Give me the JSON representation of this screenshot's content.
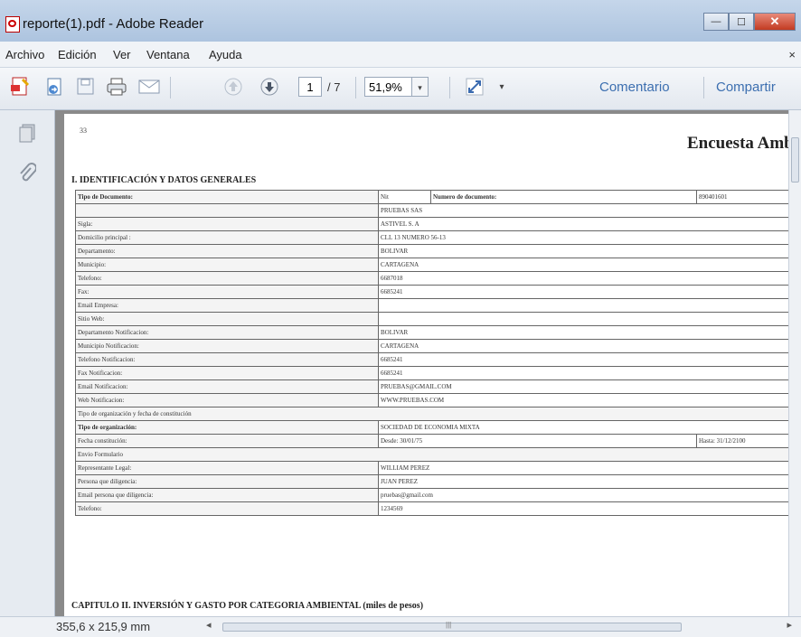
{
  "window": {
    "title": "reporte(1).pdf - Adobe Reader",
    "minimize": "—",
    "maximize": "☐",
    "close": "✕"
  },
  "menu": {
    "items": [
      "Archivo",
      "Edición",
      "Ver",
      "Ventana",
      "Ayuda"
    ],
    "close": "×"
  },
  "toolbar": {
    "page_current": "1",
    "page_total": "/ 7",
    "zoom": "51,9%",
    "comment_label": "Comentario",
    "share_label": "Compartir",
    "dropdown_arrow": "▾"
  },
  "document": {
    "header_small": "33",
    "title": "Encuesta Ambi",
    "section1": "I. IDENTIFICACIÓN Y DATOS GENERALES",
    "doc_type": {
      "label": "Tipo de Documento:",
      "value": "Nit",
      "number_label": "Numero de documento:",
      "number": "890401601"
    },
    "rows": [
      {
        "label": "",
        "value": "PRUEBAS SAS"
      },
      {
        "label": "Sigla:",
        "value": "ASTIVEL S. A"
      },
      {
        "label": "Domicilio principal :",
        "value": "CLL 13 NUMERO 56-13"
      },
      {
        "label": "Departamento:",
        "value": "BOLIVAR"
      },
      {
        "label": "Municipio:",
        "value": "CARTAGENA"
      },
      {
        "label": "Telefono:",
        "value": "6687018"
      },
      {
        "label": "Fax:",
        "value": "6685241"
      },
      {
        "label": "Email Empresa:",
        "value": ""
      },
      {
        "label": "Sitio Web:",
        "value": ""
      },
      {
        "label": "Departamento Notificacion:",
        "value": "BOLIVAR"
      },
      {
        "label": "Municipio Notificacion:",
        "value": "CARTAGENA"
      },
      {
        "label": "Telefono Notificacion:",
        "value": "6685241"
      },
      {
        "label": "Fax Notificacion:",
        "value": "6685241"
      },
      {
        "label": "Email Notificacion:",
        "value": "PRUEBAS@GMAIL.COM"
      },
      {
        "label": "Web Notificacion:",
        "value": "WWW.PRUEBAS.COM"
      }
    ],
    "org_header": "Tipo de organización y fecha de constitución",
    "org_type": {
      "label": "Tipo de organización:",
      "value": "SOCIEDAD DE ECONOMIA MIXTA"
    },
    "constitution": {
      "label": "Fecha constitución:",
      "from": "Desde: 30/01/75",
      "to": "Hasta: 31/12/2100"
    },
    "sender_header": "Envio Formulario",
    "sender_rows": [
      {
        "label": "Representante Legal:",
        "value": "WILLIAM PEREZ"
      },
      {
        "label": "Persona que diligencia:",
        "value": "JUAN PEREZ"
      },
      {
        "label": "Email persona que diligencia:",
        "value": "pruebas@gmail.com"
      },
      {
        "label": "Telefono:",
        "value": "1234569"
      }
    ],
    "section2": "CAPITULO II. INVERSIÓN Y GASTO POR CATEGORIA AMBIENTAL (miles de pesos)"
  },
  "status": {
    "page_size": "355,6 x 215,9 mm",
    "scroll_left": "◂",
    "scroll_right": "▸",
    "grip": "|||"
  }
}
